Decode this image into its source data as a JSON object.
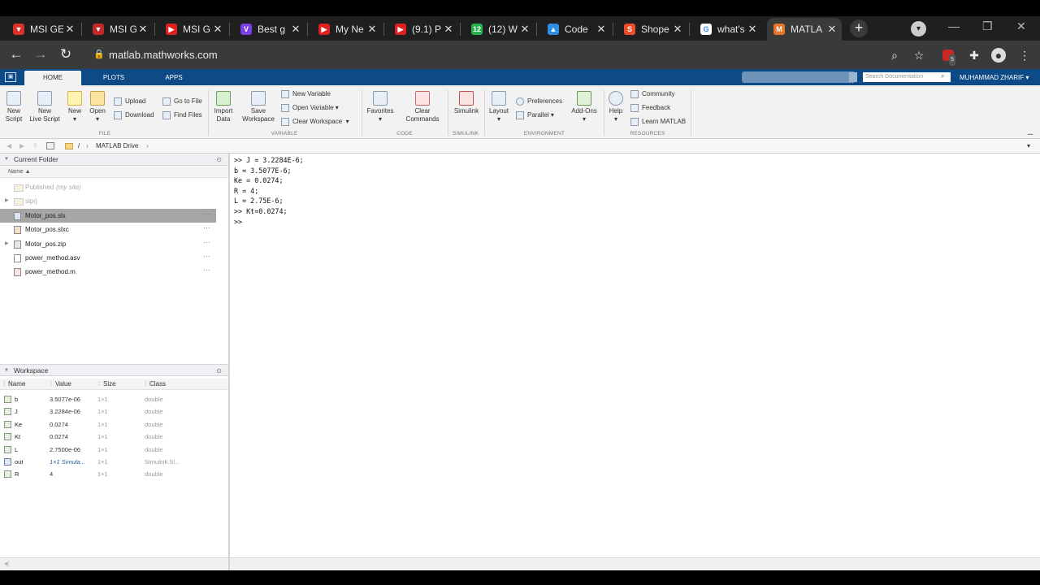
{
  "browser": {
    "tabs": [
      {
        "title": "MSI GE",
        "fav_color": "#d9322b",
        "fav_glyph": "▼"
      },
      {
        "title": "MSI GE",
        "fav_color": "#c0282a",
        "fav_glyph": "▼"
      },
      {
        "title": "MSI GE",
        "fav_color": "#e02020",
        "fav_glyph": "▶"
      },
      {
        "title": "Best g",
        "fav_color": "#7b3fe4",
        "fav_glyph": "V"
      },
      {
        "title": "My Ne",
        "fav_color": "#e02020",
        "fav_glyph": "▶"
      },
      {
        "title": "(9.1) P",
        "fav_color": "#e02020",
        "fav_glyph": "▶"
      },
      {
        "title": "(12) W",
        "fav_color": "#25b34b",
        "fav_glyph": "12"
      },
      {
        "title": "Code",
        "fav_color": "#2f8de4",
        "fav_glyph": "▲"
      },
      {
        "title": "Shope",
        "fav_color": "#ee4d2d",
        "fav_glyph": "S"
      },
      {
        "title": "what's",
        "fav_color": "#ffffff",
        "fav_glyph": "G"
      },
      {
        "title": "MATLA",
        "fav_color": "#e8742c",
        "fav_glyph": "M"
      }
    ],
    "close_glyph": "✕",
    "new_tab_glyph": "+",
    "url": "matlab.mathworks.com",
    "ext_badge": "5"
  },
  "matlab": {
    "tabs": [
      "HOME",
      "PLOTS",
      "APPS"
    ],
    "search_placeholder": "Search Documentation",
    "user": "MUHAMMAD ZHARIF",
    "ribbon": {
      "file": {
        "new_script": "New\nScript",
        "new_live_script": "New\nLive Script",
        "new": "New",
        "open": "Open",
        "upload": "Upload",
        "download": "Download",
        "go_to_file": "Go to File",
        "find_files": "Find Files",
        "label": "FILE"
      },
      "variable": {
        "import_data": "Import\nData",
        "save_workspace": "Save\nWorkspace",
        "new_variable": "New Variable",
        "open_variable": "Open Variable",
        "clear_workspace": "Clear Workspace",
        "label": "VARIABLE"
      },
      "code": {
        "favorites": "Favorites",
        "clear_commands": "Clear\nCommands",
        "label": "CODE"
      },
      "simulink": {
        "simulink": "Simulink",
        "label": "SIMULINK"
      },
      "environment": {
        "layout": "Layout",
        "preferences": "Preferences",
        "parallel": "Parallel",
        "add_ons": "Add-Ons",
        "label": "ENVIRONMENT"
      },
      "resources": {
        "help": "Help",
        "community": "Community",
        "feedback": "Feedback",
        "learn_matlab": "Learn MATLAB",
        "label": "RESOURCES"
      }
    },
    "address": {
      "sep": "/",
      "location": "MATLAB Drive"
    },
    "current_folder": {
      "title": "Current Folder",
      "name_header": "Name ▲",
      "files": [
        {
          "name": "Published",
          "suffix": "(my site)",
          "type": "folder"
        },
        {
          "name": "slprj",
          "suffix": "",
          "type": "folder"
        },
        {
          "name": "Motor_pos.slx",
          "suffix": "",
          "type": "slx"
        },
        {
          "name": "Motor_pos.slxc",
          "suffix": "",
          "type": "slxc"
        },
        {
          "name": "Motor_pos.zip",
          "suffix": "",
          "type": "zip"
        },
        {
          "name": "power_method.asv",
          "suffix": "",
          "type": "asv"
        },
        {
          "name": "power_method.m",
          "suffix": "",
          "type": "m"
        }
      ],
      "more_glyph": "···"
    },
    "workspace": {
      "title": "Workspace",
      "columns": [
        "Name",
        "Value",
        "Size",
        "Class"
      ],
      "rows": [
        {
          "name": "b",
          "value": "3.5077e-06",
          "size": "1×1",
          "class": "double"
        },
        {
          "name": "J",
          "value": "3.2284e-06",
          "size": "1×1",
          "class": "double"
        },
        {
          "name": "Ke",
          "value": "0.0274",
          "size": "1×1",
          "class": "double"
        },
        {
          "name": "Kt",
          "value": "0.0274",
          "size": "1×1",
          "class": "double"
        },
        {
          "name": "L",
          "value": "2.7500e-06",
          "size": "1×1",
          "class": "double"
        },
        {
          "name": "out",
          "value": "1×1 Simula...",
          "size": "1×1",
          "class": "Simulink.Si..."
        },
        {
          "name": "R",
          "value": "4",
          "size": "1×1",
          "class": "double"
        }
      ]
    },
    "command_window": {
      "lines": [
        ">> J = 3.2284E-6;",
        "b = 3.5077E-6;",
        "Ke = 0.0274;",
        "R = 4;",
        "L = 2.75E-6;",
        ">> Kt=0.0274;",
        ">>"
      ]
    }
  }
}
